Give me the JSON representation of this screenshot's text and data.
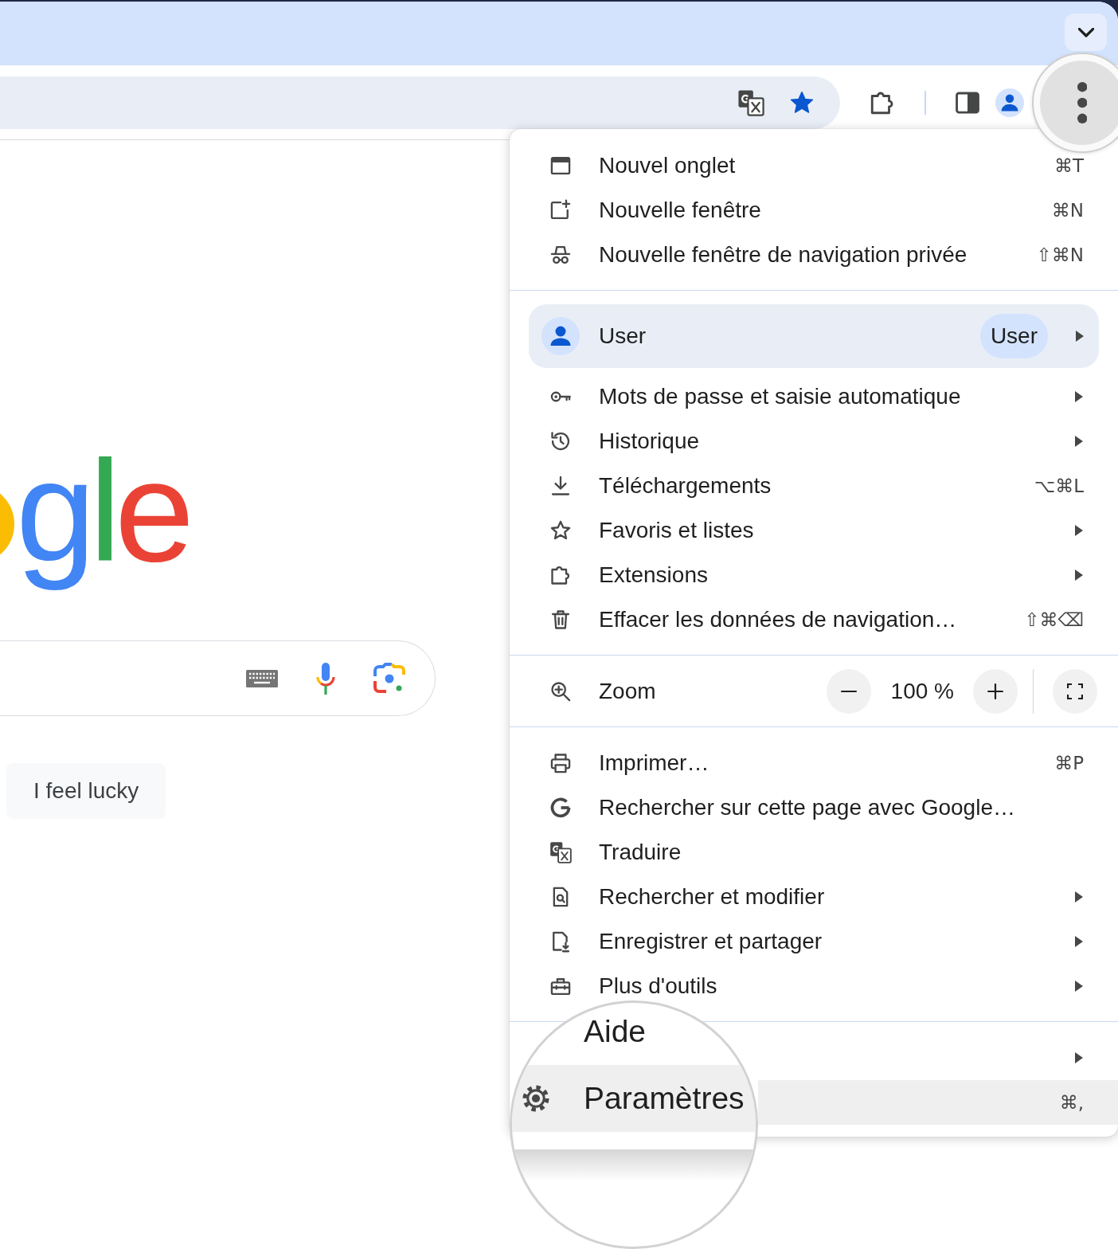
{
  "toolbar": {
    "bookmarked": true,
    "menu_button": {
      "active": true,
      "magnified": true
    }
  },
  "page": {
    "logo": [
      {
        "letter": "g",
        "color": "#4285f4"
      },
      {
        "letter": "l",
        "color": "#34a853"
      },
      {
        "letter": "e",
        "color": "#ea4335"
      }
    ],
    "lucky_button": "I feel lucky"
  },
  "menu": {
    "sections": [
      {
        "items": [
          {
            "kind": "item",
            "label": "Nouvel onglet",
            "shortcut": "⌘T",
            "submenu": false,
            "highlighted": false,
            "magnified": false
          },
          {
            "kind": "item",
            "label": "Nouvelle fenêtre",
            "shortcut": "⌘N",
            "submenu": false,
            "highlighted": false,
            "magnified": false
          },
          {
            "kind": "item",
            "label": "Nouvelle fenêtre de navigation privée",
            "shortcut": "⇧⌘N",
            "submenu": false,
            "highlighted": false,
            "magnified": false
          }
        ]
      },
      {
        "items": [
          {
            "kind": "profile",
            "label": "User",
            "badge": "User",
            "submenu": true
          },
          {
            "kind": "item",
            "label": "Mots de passe et saisie automatique",
            "submenu": true,
            "highlighted": false,
            "magnified": false
          },
          {
            "kind": "item",
            "label": "Historique",
            "submenu": true,
            "highlighted": false,
            "magnified": false
          },
          {
            "kind": "item",
            "label": "Téléchargements",
            "shortcut": "⌥⌘L",
            "submenu": false,
            "highlighted": false,
            "magnified": false
          },
          {
            "kind": "item",
            "label": "Favoris et listes",
            "submenu": true,
            "highlighted": false,
            "magnified": false
          },
          {
            "kind": "item",
            "label": "Extensions",
            "submenu": true,
            "highlighted": false,
            "magnified": false
          },
          {
            "kind": "item",
            "label": "Effacer les données de navigation…",
            "shortcut": "⇧⌘⌫",
            "submenu": false,
            "highlighted": false,
            "magnified": false
          }
        ]
      },
      {
        "items": [
          {
            "kind": "zoom",
            "label": "Zoom",
            "value": "100 %"
          }
        ]
      },
      {
        "items": [
          {
            "kind": "item",
            "label": "Imprimer…",
            "shortcut": "⌘P",
            "submenu": false,
            "highlighted": false,
            "magnified": false
          },
          {
            "kind": "item",
            "label": "Rechercher sur cette page avec Google…",
            "submenu": false,
            "highlighted": false,
            "magnified": false
          },
          {
            "kind": "item",
            "label": "Traduire",
            "submenu": false,
            "highlighted": false,
            "magnified": false
          },
          {
            "kind": "item",
            "label": "Rechercher et modifier",
            "submenu": true,
            "highlighted": false,
            "magnified": false
          },
          {
            "kind": "item",
            "label": "Enregistrer et partager",
            "submenu": true,
            "highlighted": false,
            "magnified": false
          },
          {
            "kind": "item",
            "label": "Plus d'outils",
            "submenu": true,
            "highlighted": false,
            "magnified": false
          }
        ]
      },
      {
        "items": [
          {
            "kind": "item",
            "label": "Aide",
            "submenu": true,
            "highlighted": false,
            "magnified": true
          },
          {
            "kind": "item",
            "label": "Paramètres",
            "shortcut": "⌘,",
            "submenu": false,
            "highlighted": true,
            "magnified": true
          }
        ]
      }
    ]
  }
}
